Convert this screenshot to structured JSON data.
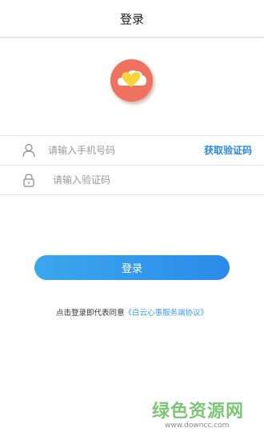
{
  "header": {
    "title": "登录"
  },
  "colors": {
    "accent": "#2b8bea",
    "logo_bg": "#ef7260",
    "link": "#3a9be8"
  },
  "logo": {
    "icon": "heart-cloud-icon"
  },
  "phone_field": {
    "icon": "user-icon",
    "placeholder": "请输入手机号码",
    "value": ""
  },
  "get_code_label": "获取验证码",
  "code_field": {
    "icon": "lock-icon",
    "placeholder": "请输入验证码",
    "value": ""
  },
  "login_button": {
    "label": "登录"
  },
  "agreement": {
    "prefix": "点击登录即代表同意",
    "link": "《白云心事服务端协议》"
  },
  "watermark": {
    "text": "绿色资源网",
    "url": "www.downcc.com"
  }
}
